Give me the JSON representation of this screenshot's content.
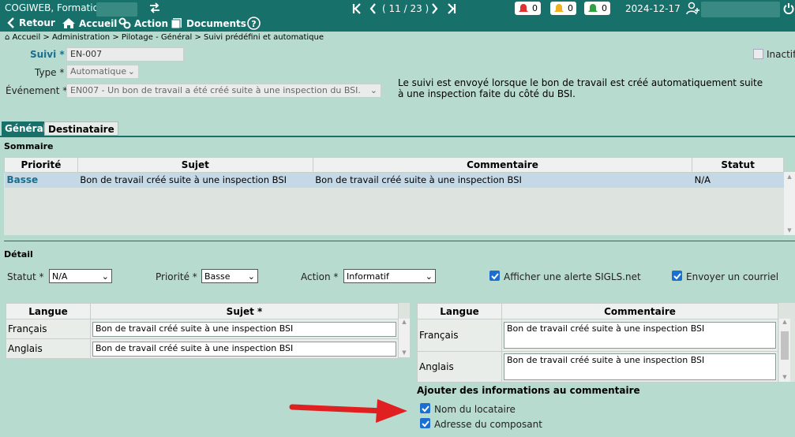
{
  "header": {
    "app_title": "COGIWEB, Formation",
    "nav": {
      "retour": "Retour",
      "accueil": "Accueil",
      "action": "Action",
      "documents": "Documents"
    },
    "pager": "( 11 / 23 )",
    "alerts": {
      "red": "0",
      "yellow": "0",
      "green": "0"
    },
    "date": "2024-12-17"
  },
  "breadcrumb": "Accueil > Administration > Pilotage - Général > Suivi prédéfini et automatique",
  "form": {
    "suivi_label": "Suivi *",
    "suivi_value": "EN-007",
    "type_label": "Type *",
    "type_value": "Automatique",
    "evenement_label": "Événement *",
    "evenement_value": "EN007 - Un bon de travail a été créé suite à une inspection du BSI.",
    "inactif_label": "Inactif",
    "description": "Le suivi est envoyé lorsque le bon de travail est créé automatiquement suite à une inspection faite du côté du BSI."
  },
  "tabs": [
    "Général",
    "Destinataire"
  ],
  "sommaire": {
    "title": "Sommaire",
    "columns": [
      "Priorité",
      "Sujet",
      "Commentaire",
      "Statut"
    ],
    "rows": [
      {
        "priorite": "Basse",
        "sujet": "Bon de travail créé suite à une inspection BSI",
        "commentaire": "Bon de travail créé suite à une inspection BSI",
        "statut": "N/A"
      }
    ]
  },
  "detail": {
    "title": "Détail",
    "statut_label": "Statut *",
    "statut_value": "N/A",
    "priorite_label": "Priorité *",
    "priorite_value": "Basse",
    "action_label": "Action *",
    "action_value": "Informatif",
    "alerte_label": "Afficher une alerte SIGLS.net",
    "courriel_label": "Envoyer un courriel"
  },
  "sujet_table": {
    "columns": [
      "Langue",
      "Sujet *"
    ],
    "rows": [
      {
        "langue": "Français",
        "valeur": "Bon de travail créé suite à une inspection BSI"
      },
      {
        "langue": "Anglais",
        "valeur": "Bon de travail créé suite à une inspection BSI"
      }
    ]
  },
  "commentaire_table": {
    "columns": [
      "Langue",
      "Commentaire"
    ],
    "rows": [
      {
        "langue": "Français",
        "valeur": "Bon de travail créé suite à une inspection BSI"
      },
      {
        "langue": "Anglais",
        "valeur": "Bon de travail créé suite à une inspection BSI"
      }
    ]
  },
  "ajouter": {
    "title": "Ajouter des informations au commentaire",
    "nom_locataire": "Nom du locataire",
    "adresse_composant": "Adresse du composant"
  },
  "colors": {
    "header_bg": "#17706a",
    "page_bg": "#b7dccf",
    "checkbox": "#1a6fd0",
    "arrow": "#e02020"
  }
}
